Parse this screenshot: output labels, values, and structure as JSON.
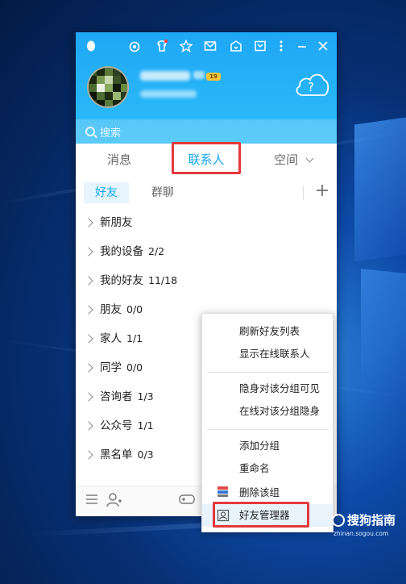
{
  "window": {
    "search_placeholder": "搜索",
    "level_badge": "19"
  },
  "tabs": [
    {
      "label": "消息"
    },
    {
      "label": "联系人"
    },
    {
      "label": "空间"
    }
  ],
  "subtabs": [
    {
      "label": "好友"
    },
    {
      "label": "群聊"
    }
  ],
  "groups": [
    {
      "name": "新朋友",
      "count": ""
    },
    {
      "name": "我的设备",
      "count": "2/2"
    },
    {
      "name": "我的好友",
      "count": "11/18"
    },
    {
      "name": "朋友",
      "count": "0/0"
    },
    {
      "name": "家人",
      "count": "1/1"
    },
    {
      "name": "同学",
      "count": "0/0"
    },
    {
      "name": "咨询者",
      "count": "1/3"
    },
    {
      "name": "公众号",
      "count": "1/1"
    },
    {
      "name": "黑名单",
      "count": "0/3"
    }
  ],
  "context_menu": {
    "items": [
      {
        "label": "刷新好友列表"
      },
      {
        "label": "显示在线联系人"
      },
      {
        "label": "隐身对该分组可见"
      },
      {
        "label": "在线对该分组隐身"
      },
      {
        "label": "添加分组"
      },
      {
        "label": "重命名"
      },
      {
        "label": "删除该组"
      },
      {
        "label": "好友管理器"
      }
    ]
  },
  "watermark": {
    "brand": "搜狗指南",
    "url": "zhinan.sogou.com"
  },
  "colors": {
    "accent": "#12a6ef",
    "header": "#29b8f7",
    "highlight_box": "#e4393c"
  }
}
